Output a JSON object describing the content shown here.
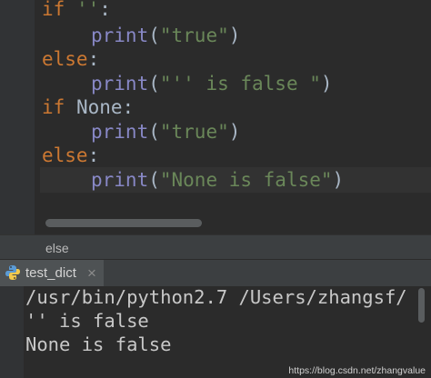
{
  "editor": {
    "lines": [
      {
        "kw": "if",
        "str": "''",
        "colon": ":"
      },
      {
        "fn": "print",
        "open": "(",
        "str": "\"true\"",
        "close": ")"
      },
      {
        "kw": "else",
        "colon": ":"
      },
      {
        "fn": "print",
        "open": "(",
        "str": "\"'' is false \"",
        "close": ")"
      },
      {
        "kw": "if",
        "val": "None",
        "colon": ":"
      },
      {
        "fn": "print",
        "open": "(",
        "str": "\"true\"",
        "close": ")"
      },
      {
        "kw": "else",
        "colon": ":"
      },
      {
        "fn": "print",
        "open": "(",
        "str": "\"None is false\"",
        "close": ")"
      }
    ]
  },
  "breadcrumb": {
    "text": "else"
  },
  "run_tab": {
    "label": "test_dict",
    "icon": "python-icon",
    "close_icon": "close-icon",
    "close_glyph": "×"
  },
  "console": {
    "lines": [
      "/usr/bin/python2.7 /Users/zhangsf/",
      "'' is false",
      "None is false"
    ]
  },
  "watermark": {
    "text": "https://blog.csdn.net/zhangvalue"
  },
  "colors": {
    "keyword": "#cc7832",
    "builtin": "#8888c6",
    "string": "#6a8759",
    "text": "#a9b7c6",
    "background": "#2b2b2b"
  }
}
